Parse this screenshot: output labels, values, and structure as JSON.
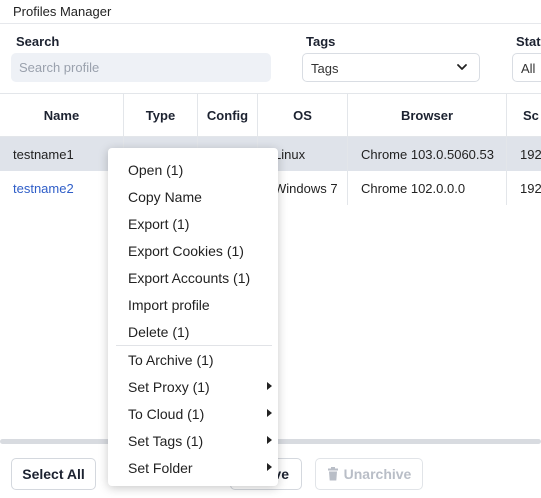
{
  "window": {
    "title": "Profiles Manager"
  },
  "filters": {
    "search_label": "Search",
    "search_placeholder": "Search profile",
    "search_value": "",
    "tags_label": "Tags",
    "tags_value": "Tags",
    "status_label": "Stat",
    "status_value": "All"
  },
  "table": {
    "columns": [
      "Name",
      "Type",
      "Config",
      "OS",
      "Browser",
      "Sc"
    ],
    "rows": [
      {
        "name": "testname1",
        "os": "Linux",
        "browser": "Chrome 103.0.5060.53",
        "extra": "192"
      },
      {
        "name": "testname2",
        "os": "Windows 7",
        "browser": "Chrome 102.0.0.0",
        "extra": "192"
      }
    ]
  },
  "context_menu": {
    "items": [
      {
        "label": "Open (1)"
      },
      {
        "label": "Copy Name"
      },
      {
        "label": "Export (1)"
      },
      {
        "label": "Export Cookies (1)"
      },
      {
        "label": "Export Accounts (1)"
      },
      {
        "label": "Import profile"
      },
      {
        "label": "Delete (1)"
      },
      {
        "label": "To Archive (1)"
      },
      {
        "label": "Set Proxy (1)",
        "submenu": true
      },
      {
        "label": "To Cloud (1)",
        "submenu": true
      },
      {
        "label": "Set Tags (1)",
        "submenu": true
      },
      {
        "label": "Set Folder",
        "submenu": true
      }
    ]
  },
  "footer": {
    "select_all": "Select All",
    "archive_partial": "ve",
    "unarchive": "Unarchive"
  }
}
